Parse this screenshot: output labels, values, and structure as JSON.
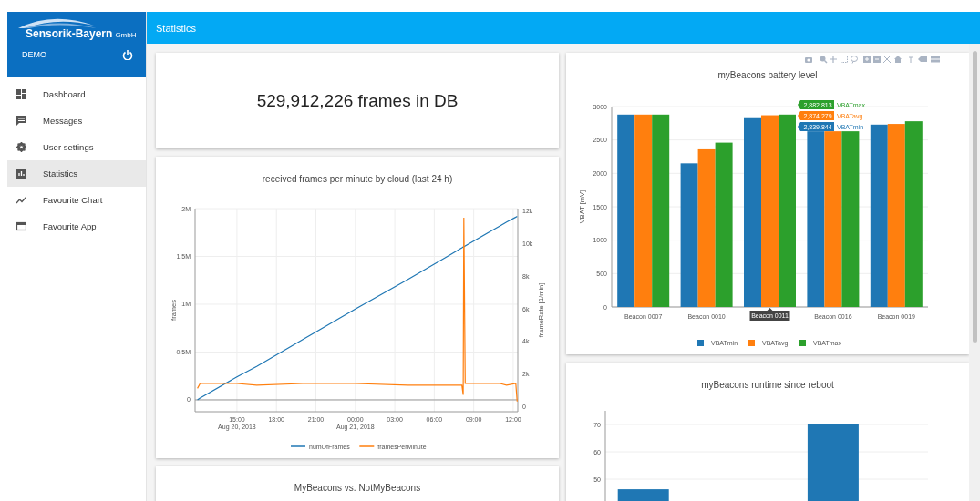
{
  "brand": {
    "name": "Sensorik-Bayern",
    "suffix": "GmbH"
  },
  "user": {
    "label": "DEMO"
  },
  "nav": [
    {
      "label": "Dashboard",
      "kind": "dashboard",
      "selected": false
    },
    {
      "label": "Messages",
      "kind": "messages",
      "selected": false
    },
    {
      "label": "User settings",
      "kind": "settings",
      "selected": false
    },
    {
      "label": "Statistics",
      "kind": "statistics",
      "selected": true
    },
    {
      "label": "Favourite Chart",
      "kind": "chart",
      "selected": false
    },
    {
      "label": "Favourite App",
      "kind": "app",
      "selected": false
    }
  ],
  "header": {
    "title": "Statistics"
  },
  "columns": [
    [
      {
        "kind": "counter",
        "text": "529,912,226 frames in DB"
      },
      {
        "kind": "chart",
        "chart_data": {
          "type": "line",
          "title": "received frames per minute by cloud (last 24 h)",
          "ylabel": "frames",
          "y2label": "frameRate [1/min]",
          "grid": true,
          "legend": "bottom",
          "x": [
            "2018-08-20 12:00",
            "2018-08-20 12:12",
            "2018-08-20 15:00",
            "2018-08-20 16:30",
            "2018-08-20 20:00",
            "2018-08-21 00:00",
            "2018-08-21 04:00",
            "2018-08-21 07:00",
            "2018-08-21 08:06",
            "2018-08-21 08:12",
            "2018-08-21 08:15",
            "2018-08-21 08:21",
            "2018-08-21 11:00",
            "2018-08-21 11:30",
            "2018-08-21 12:12",
            "2018-08-21 12:18"
          ],
          "series": [
            {
              "name": "numOfFrames",
              "color": "#1f77b4",
              "values": [
                0,
                20000,
                240000,
                350000,
                630000,
                950000,
                1260000,
                1500000,
                1590000,
                1600000,
                1600000,
                1610000,
                1820000,
                1860000,
                1910000,
                1920000
              ]
            },
            {
              "name": "framesPerMinute",
              "color": "#ff7f0e",
              "axis": "y2",
              "values": [
                1100,
                1400,
                1400,
                1300,
                1400,
                1400,
                1300,
                1300,
                1300,
                700,
                11600,
                1400,
                1400,
                1300,
                1400,
                300
              ]
            }
          ],
          "xlim": [
            "2018-08-20 11:49",
            "2018-08-21 12:21"
          ],
          "ylim": [
            -124000,
            2000000
          ],
          "y2lim": [
            -336,
            12168
          ],
          "xticks": [
            {
              "value": "2018-08-20 15:00",
              "label": "15:00\nAug 20, 2018"
            },
            {
              "value": "2018-08-20 18:00",
              "label": "18:00"
            },
            {
              "value": "2018-08-20 21:00",
              "label": "21:00"
            },
            {
              "value": "2018-08-21 00:00",
              "label": "00:00\nAug 21, 2018"
            },
            {
              "value": "2018-08-21 03:00",
              "label": "03:00"
            },
            {
              "value": "2018-08-21 06:00",
              "label": "06:00"
            },
            {
              "value": "2018-08-21 09:00",
              "label": "09:00"
            },
            {
              "value": "2018-08-21 12:00",
              "label": "12:00"
            }
          ],
          "yticks": [
            {
              "value": 0,
              "label": "0"
            },
            {
              "value": 500000,
              "label": "0.5M"
            },
            {
              "value": 1000000,
              "label": "1M"
            },
            {
              "value": 1500000,
              "label": "1.5M"
            },
            {
              "value": 2000000,
              "label": "2M"
            }
          ],
          "y2ticks": [
            {
              "value": 0,
              "label": "0"
            },
            {
              "value": 2000,
              "label": "2k"
            },
            {
              "value": 4000,
              "label": "4k"
            },
            {
              "value": 6000,
              "label": "6k"
            },
            {
              "value": 8000,
              "label": "8k"
            },
            {
              "value": 10000,
              "label": "10k"
            },
            {
              "value": 12000,
              "label": "12k"
            }
          ]
        }
      },
      {
        "kind": "title_only",
        "title": "MyBeacons vs. NotMyBeacons"
      }
    ],
    [
      {
        "kind": "chart",
        "toolbar": true,
        "chart_data": {
          "type": "bar",
          "title": "myBeacons battery level",
          "ylabel": "VBAT [mV]",
          "grid": true,
          "legend": "bottom",
          "categories": [
            "Beacon 0007",
            "Beacon 0010",
            "Beacon 0011",
            "Beacon 0016",
            "Beacon 0019"
          ],
          "series": [
            {
              "name": "VBATmin",
              "color": "#1f77b4",
              "values": [
                2880,
                2150,
                2840,
                2630,
                2730
              ]
            },
            {
              "name": "VBATavg",
              "color": "#ff7f0e",
              "values": [
                2880,
                2360,
                2870,
                2630,
                2740
              ]
            },
            {
              "name": "VBATmax",
              "color": "#2ca02c",
              "values": [
                2880,
                2460,
                2880,
                2630,
                2780
              ]
            }
          ],
          "ylim": [
            0,
            3000
          ],
          "yticks": [
            0,
            500,
            1000,
            1500,
            2000,
            2500,
            3000
          ]
        },
        "hover": {
          "at": [
            false,
            false,
            true,
            false,
            false
          ],
          "items": [
            {
              "value": "2,882.813",
              "name": "VBATmax",
              "color": "#2ca02c"
            },
            {
              "value": "2,874.279",
              "name": "VBATavg",
              "color": "#ff7f0e"
            },
            {
              "value": "2,839.844",
              "name": "VBATmin",
              "color": "#1f77b4"
            }
          ]
        }
      },
      {
        "kind": "chart",
        "chart_data": {
          "type": "bar",
          "title": "myBeacons runtime since reboot",
          "grid": true,
          "series": [
            {
              "color": "#1f77b4",
              "values": [
                46.3,
                null,
                null,
                70.3,
                null
              ]
            }
          ],
          "ylim": [
            0,
            75
          ],
          "yticks": [
            50,
            60,
            70
          ]
        }
      }
    ]
  ]
}
